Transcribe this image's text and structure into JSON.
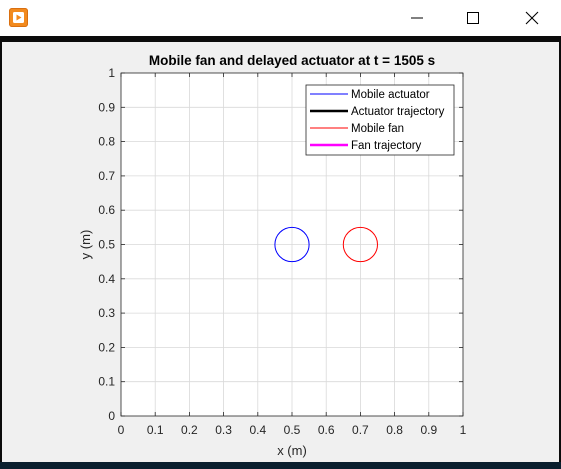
{
  "window": {
    "icon": "matlab-figure-icon",
    "controls": [
      "minimize-icon",
      "maximize-icon",
      "close-icon"
    ]
  },
  "colors": {
    "actuator": "#0000ff",
    "actuator_trajectory": "#000000",
    "fan": "#ff0000",
    "fan_trajectory": "#ff00ff",
    "figure_background": "#f0f0f0",
    "grid": "#d9d9d9"
  },
  "chart_data": {
    "type": "scatter",
    "title": "Mobile fan and delayed actuator at t = 1505 s",
    "xlabel": "x (m)",
    "ylabel": "y (m)",
    "xlim": [
      0,
      1
    ],
    "ylim": [
      0,
      1
    ],
    "grid": true,
    "legend_position": "top-right",
    "x_ticks": [
      "0",
      "0.1",
      "0.2",
      "0.3",
      "0.4",
      "0.5",
      "0.6",
      "0.7",
      "0.8",
      "0.9",
      "1"
    ],
    "y_ticks": [
      "0",
      "0.1",
      "0.2",
      "0.3",
      "0.4",
      "0.5",
      "0.6",
      "0.7",
      "0.8",
      "0.9",
      "1"
    ],
    "legend": [
      {
        "name": "Mobile actuator",
        "style": "thin-line",
        "color": "#0000ff"
      },
      {
        "name": "Actuator trajectory",
        "style": "thick-line",
        "color": "#000000"
      },
      {
        "name": "Mobile fan",
        "style": "thin-line",
        "color": "#ff0000"
      },
      {
        "name": "Fan trajectory",
        "style": "thick-line",
        "color": "#ff00ff"
      }
    ],
    "series": [
      {
        "name": "Mobile actuator",
        "shape": "circle",
        "center": [
          0.5,
          0.5
        ],
        "radius": 0.05,
        "color": "#0000ff"
      },
      {
        "name": "Mobile fan",
        "shape": "circle",
        "center": [
          0.7,
          0.5
        ],
        "radius": 0.05,
        "color": "#ff0000"
      }
    ]
  }
}
